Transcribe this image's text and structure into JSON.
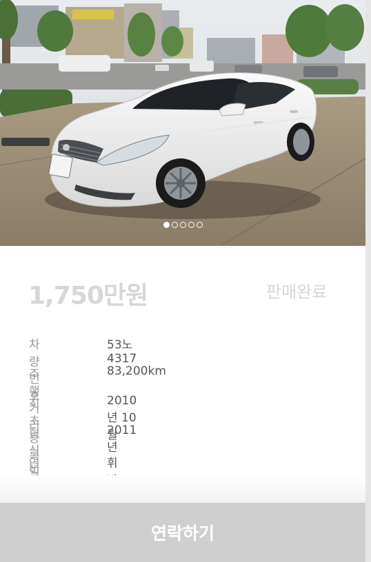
{
  "listing": {
    "price": "1,750만원",
    "status": "판매완료",
    "photo_pages": [
      true,
      false,
      false,
      false,
      false
    ],
    "specs": [
      {
        "label": "차량번호",
        "value": "53노4317"
      },
      {
        "label": "주행거리",
        "value": "83,200km"
      },
      {
        "label": "최초등록일",
        "value": "2010년 10월"
      },
      {
        "label": "형식년도",
        "value": "2011년"
      },
      {
        "label": "연료",
        "value": "휘발유"
      }
    ]
  },
  "actions": {
    "contact_label": "연락하기"
  },
  "colors": {
    "sold_text": "#d6d6d6",
    "label_text": "#9a9a9a",
    "value_text": "#555555",
    "contact_bg": "#cfcfcf"
  }
}
